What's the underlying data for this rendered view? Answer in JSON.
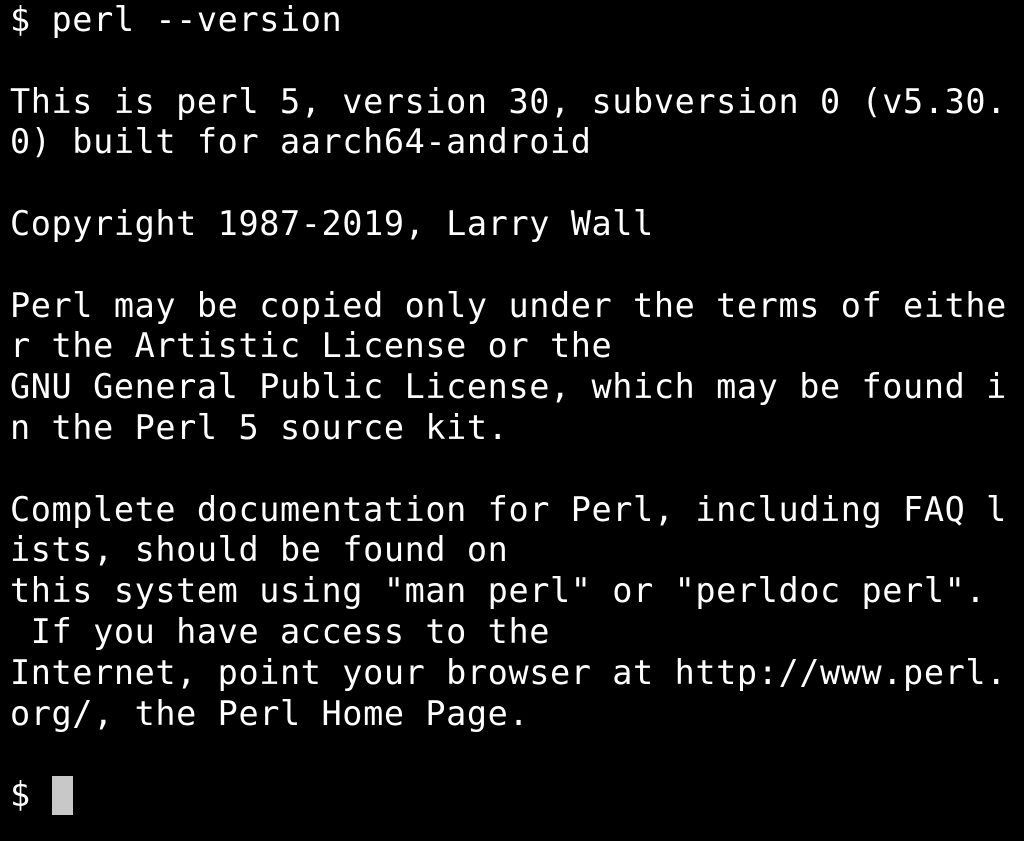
{
  "terminal": {
    "background": "#000000",
    "foreground": "#ffffff",
    "cursor_color": "#c8c8c8",
    "lines": [
      "$ perl --version",
      "",
      "This is perl 5, version 30, subversion 0 (v5.30.",
      "0) built for aarch64-android",
      "",
      "Copyright 1987-2019, Larry Wall",
      "",
      "Perl may be copied only under the terms of eithe",
      "r the Artistic License or the",
      "GNU General Public License, which may be found i",
      "n the Perl 5 source kit.",
      "",
      "Complete documentation for Perl, including FAQ l",
      "ists, should be found on",
      "this system using \"man perl\" or \"perldoc perl\".",
      " If you have access to the",
      "Internet, point your browser at http://www.perl.",
      "org/, the Perl Home Page.",
      ""
    ],
    "prompt": {
      "symbol": "$ "
    }
  }
}
